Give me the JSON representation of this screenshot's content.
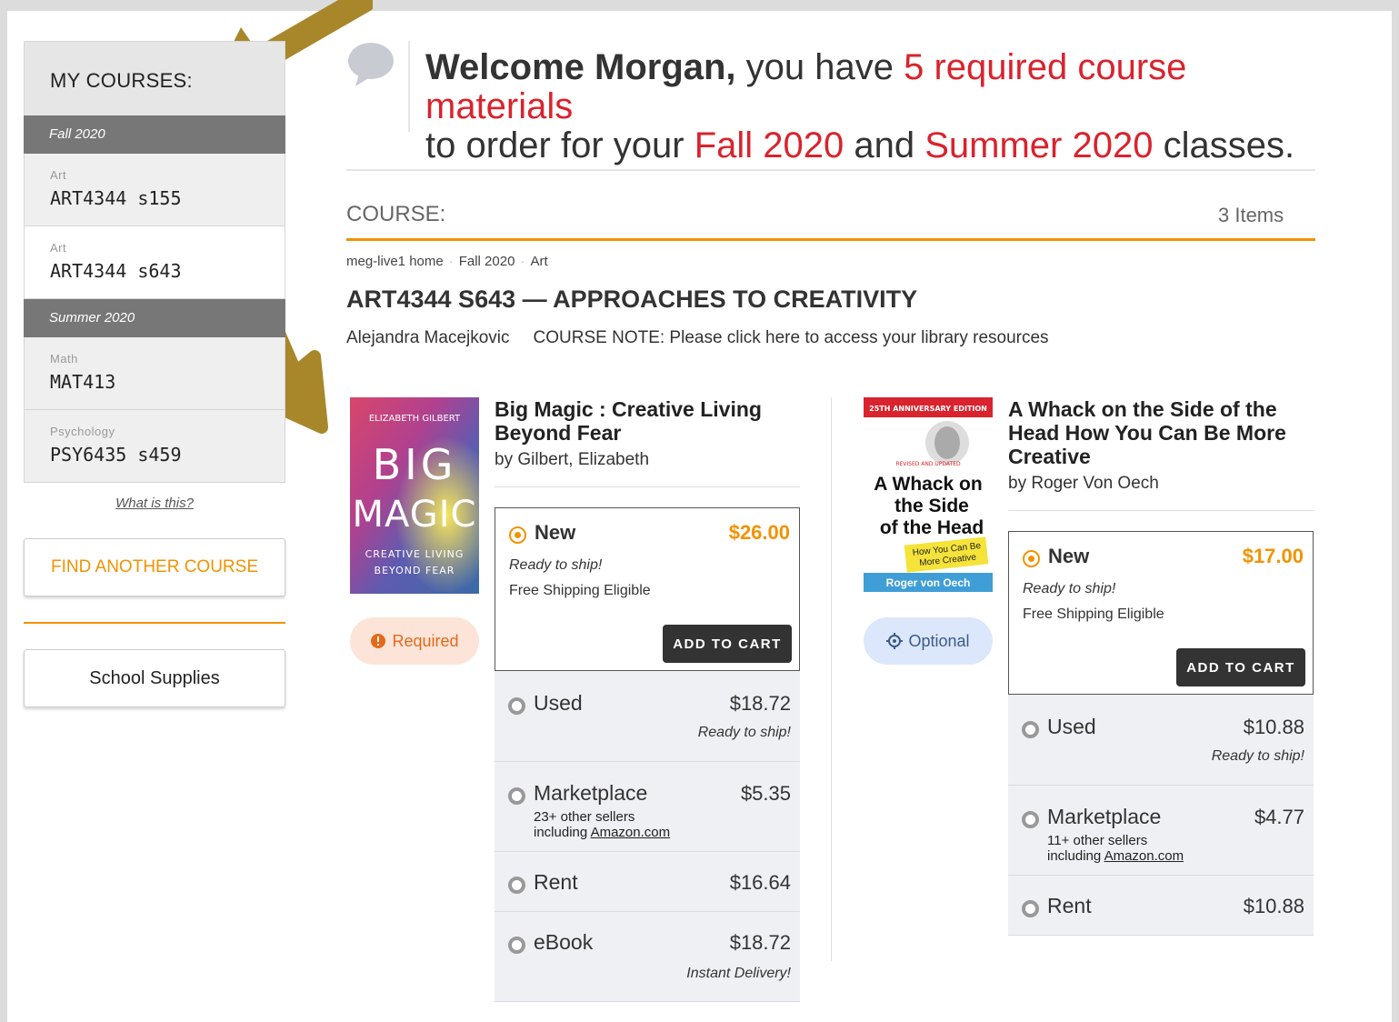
{
  "sidebar": {
    "header": "MY COURSES:",
    "terms": [
      {
        "label": "Fall 2020",
        "courses": [
          {
            "dept": "Art",
            "code": "ART4344 s155"
          },
          {
            "dept": "Art",
            "code": "ART4344 s643"
          }
        ]
      },
      {
        "label": "Summer 2020",
        "courses": [
          {
            "dept": "Math",
            "code": "MAT413"
          },
          {
            "dept": "Psychology",
            "code": "PSY6435 s459"
          }
        ]
      }
    ],
    "what_is_this": "What is this?",
    "find_another": "FIND ANOTHER COURSE",
    "school_supplies": "School Supplies"
  },
  "welcome": {
    "name": "Welcome Morgan,",
    "t1": " you have ",
    "count_text": "5 required course materials",
    "t2": "to order for your ",
    "term1": "Fall 2020",
    "t3": " and ",
    "term2": "Summer 2020",
    "t4": " classes."
  },
  "course": {
    "label": "COURSE:",
    "items_count": "3 Items",
    "breadcrumb": [
      "meg-live1 home",
      "Fall 2020",
      "Art"
    ],
    "title": "ART4344 S643 — APPROACHES TO CREATIVITY",
    "instructor": "Alejandra Macejkovic",
    "note": "COURSE NOTE: Please click here to access your library resources"
  },
  "books": [
    {
      "title": "Big Magic : Creative Living Beyond Fear",
      "author": "by Gilbert, Elizabeth",
      "badge": "Required",
      "cover": {
        "top": "ELIZABETH GILBERT",
        "line1": "BIG",
        "line2": "MAGIC",
        "sub1": "CREATIVE LIVING",
        "sub2": "BEYOND FEAR"
      },
      "new": {
        "label": "New",
        "price": "$26.00",
        "ship1": "Ready to ship!",
        "ship2": "Free Shipping Eligible",
        "cta": "ADD TO CART"
      },
      "options": [
        {
          "label": "Used",
          "price": "$18.72",
          "note": "Ready to ship!"
        },
        {
          "label": "Marketplace",
          "price": "$5.35",
          "sellers": "23+ other sellers",
          "including": "including ",
          "amazon": "Amazon.com"
        },
        {
          "label": "Rent",
          "price": "$16.64"
        },
        {
          "label": "eBook",
          "price": "$18.72",
          "note": "Instant Delivery!"
        }
      ]
    },
    {
      "title": "A Whack on the Side of the Head How You Can Be More Creative",
      "author": "by Roger Von Oech",
      "badge": "Optional",
      "cover": {
        "banner": "25TH ANNIVERSARY EDITION",
        "revised": "REVISED AND UPDATED",
        "line1": "A Whack on",
        "line2": "the Side",
        "line3": "of the Head",
        "tag1": "How You Can Be",
        "tag2": "More Creative",
        "author": "Roger von Oech"
      },
      "new": {
        "label": "New",
        "price": "$17.00",
        "ship1": "Ready to ship!",
        "ship2": "Free Shipping Eligible",
        "cta": "ADD TO CART"
      },
      "options": [
        {
          "label": "Used",
          "price": "$10.88",
          "note": "Ready to ship!"
        },
        {
          "label": "Marketplace",
          "price": "$4.77",
          "sellers": "11+ other sellers",
          "including": "including ",
          "amazon": "Amazon.com"
        },
        {
          "label": "Rent",
          "price": "$10.88"
        }
      ]
    }
  ],
  "colors": {
    "accent": "#f39200",
    "red": "#d9232e",
    "annotation_arrow": "#a8872a"
  }
}
